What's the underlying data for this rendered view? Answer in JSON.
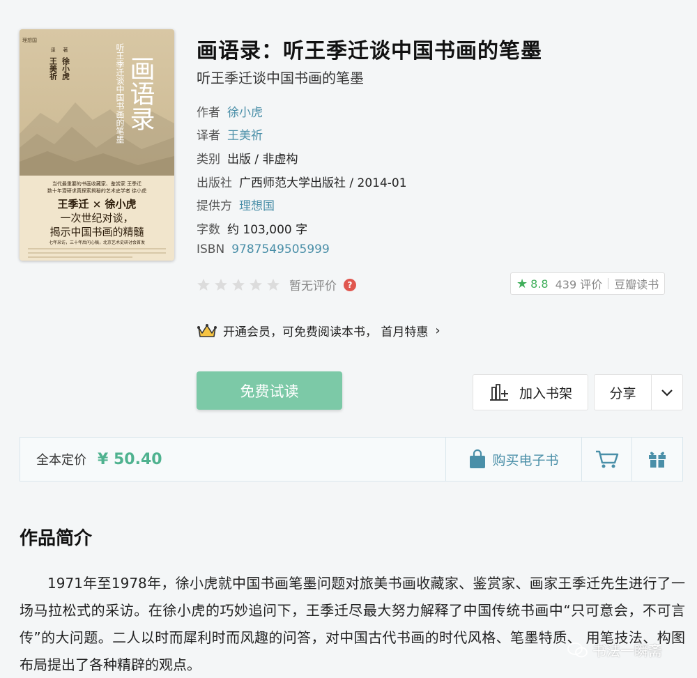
{
  "book": {
    "title": "画语录：听王季迁谈中国书画的笔墨",
    "subtitle": "听王季迁谈中国书画的笔墨",
    "meta": [
      {
        "key": "作者",
        "value": "徐小虎",
        "link": true
      },
      {
        "key": "译者",
        "value": "王美祈",
        "link": true
      },
      {
        "key": "类别",
        "value": "出版 / 非虚构",
        "link": false
      },
      {
        "key": "出版社",
        "value": "广西师范大学出版社 / 2014-01",
        "link": false
      },
      {
        "key": "提供方",
        "value": "理想国",
        "link": true
      },
      {
        "key": "字数",
        "value": "约 103,000 字",
        "link": false
      },
      {
        "key": "ISBN",
        "value": "9787549505999",
        "link": true
      }
    ]
  },
  "cover": {
    "publisher_mark": "理想国",
    "big_title": "画语录",
    "vertical_subtitle": "听王季迁谈中国书画的笔墨",
    "author_line": "徐小虎",
    "author_role": "著",
    "translator_line": "王美祈",
    "translator_role": "译",
    "blurb_small_1": "当代最重要的书画收藏家、鉴赏家 王季迁",
    "blurb_small_2": "数十年潜研求真探索揭秘的艺术史学者 徐小虎",
    "blurb_big_1": "王季迁 × 徐小虎",
    "blurb_big_2": "一次世纪对谈，",
    "blurb_big_3": "揭示中国书画的精髓",
    "blurb_small_3": "七年采访，三十年后问心稿，北京艺术史研讨会首发",
    "rating_level": 0
  },
  "rating": {
    "stars_filled": 0,
    "stars_total": 5,
    "no_rating_text": "暂无评价",
    "help_icon": "?"
  },
  "douban": {
    "score": "8.8",
    "count_text": "439 评价",
    "source": "豆瓣读书",
    "star_color": "#3fae5a"
  },
  "membership": {
    "text": "开通会员，可免费阅读本书， 首月特惠",
    "icon": "crown-icon"
  },
  "actions": {
    "read_label": "免费试读",
    "shelf_label": "加入书架",
    "share_label": "分享"
  },
  "price": {
    "label": "全本定价",
    "value": "¥ 50.40",
    "buy_label": "购买电子书"
  },
  "intro": {
    "heading": "作品简介",
    "text": "1971年至1978年，徐小虎就中国书画笔墨问题对旅美书画收藏家、鉴赏家、画家王季迁先生进行了一场马拉松式的采访。在徐小虎的巧妙追问下，王季迁尽最大努力解释了中国传统书画中“只可意会，不可言传”的大问题。二人以时而犀利时而风趣的问答，对中国古代书画的时代风格、笔墨特质、 用笔技法、构图布局提出了各种精辟的观点。"
  },
  "watermark": {
    "text": "书法一瞬斋"
  },
  "colors": {
    "accent_green": "#7cc9a7",
    "price_green": "#4fb28f",
    "link_blue": "#4a8fa8"
  }
}
